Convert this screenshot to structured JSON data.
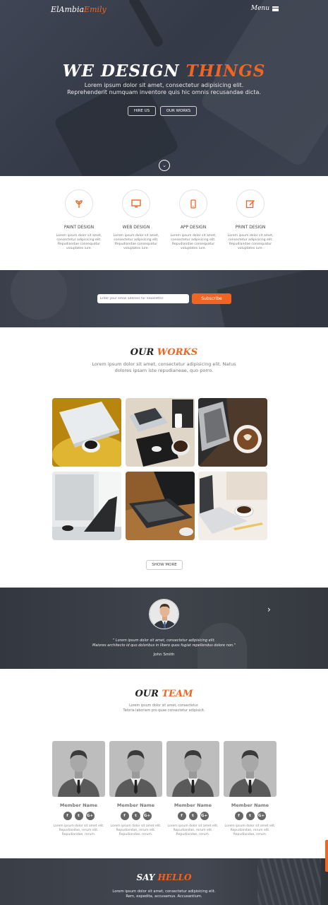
{
  "hero": {
    "logo_main": "ElAmbiaEmily",
    "logo_a": "ElAmbia",
    "logo_b": "Emily",
    "menu_label": "Menu",
    "title_a": "WE DESIGN ",
    "title_b": "THINGS",
    "subtitle_1": "Lorem ipsum dolor sit amet, consectetur adipisicing elit.",
    "subtitle_2": "Reprehenderit numquam inventore quis hic omnis recusandae dicta.",
    "btn_hire": "HIRE US",
    "btn_works": "OUR WORKS",
    "scroll_icon": "chevron-down-icon"
  },
  "services": [
    {
      "title": "PAINT DESIGN",
      "icon": "leaf-icon",
      "desc": "Lorem ipsum dolor sit amet, consectetur adipisicing elit. Repudiandae consequatur voluptates iure."
    },
    {
      "title": "WEB DESIGN",
      "icon": "monitor-icon",
      "desc": "Lorem ipsum dolor sit amet, consectetur adipisicing elit. Repudiandae consequatur voluptates iure."
    },
    {
      "title": "APP DESIGN",
      "icon": "mobile-icon",
      "desc": "Lorem ipsum dolor sit amet, consectetur adipisicing elit. Repudiandae consequatur voluptates iure."
    },
    {
      "title": "PRINT DESIGN",
      "icon": "edit-icon",
      "desc": "Lorem ipsum dolor sit amet, consectetur adipisicing elit. Repudiandae consequatur voluptates iure."
    }
  ],
  "subscribe": {
    "placeholder": "Enter your email address for newsletter",
    "button": "Subscribe"
  },
  "works": {
    "title_a": "OUR ",
    "title_b": "WORKS",
    "subtitle_1": "Lorem ipsum dolor sit amet, consectetur adipisicing elit. Natus",
    "subtitle_2": "dolores ipsam iste repudianeae, quo porro.",
    "show_more": "SHOW MORE"
  },
  "testimonial": {
    "quote_1": "\" Lorem ipsum dolor sit amet, consectetur adipisicing elit.",
    "quote_2": "Maiores architecto id quo doloribus in libero quos fugiat repellendus dolore non.\"",
    "name": "John Smith",
    "next_icon": "chevron-right-icon"
  },
  "team": {
    "title_a": "OUR ",
    "title_b": "TEAM",
    "subtitle_1": "Lorem ipsum dolor sit amet, consectetur.",
    "subtitle_2": "Tatoria laboriam pro quae consectetur adipisicit.",
    "members": [
      {
        "name": "Member Name",
        "desc": "Lorem ipsum dolor sit amet elit. Repudiandae, rerum elit. Repudiandae, rerum."
      },
      {
        "name": "Member Name",
        "desc": "Lorem ipsum dolor sit amet elit. Repudiandae, rerum elit. Repudiandae, rerum."
      },
      {
        "name": "Member Name",
        "desc": "Lorem ipsum dolor sit amet elit. Repudiandae, rerum elit. Repudiandae, rerum."
      },
      {
        "name": "Member Name",
        "desc": "Lorem ipsum dolor sit amet elit. Repudiandae, rerum elit. Repudiandae, rerum."
      }
    ],
    "social_icons": {
      "facebook": "f",
      "twitter": "t",
      "google": "G+"
    }
  },
  "hello": {
    "title_a": "SAY ",
    "title_b": "HELLO",
    "subtitle_1": "Lorem ipsum dolor sit amet, consectetur adipisicing elit.",
    "subtitle_2": "Rem, expedita, accusamus. Accusantium."
  },
  "colors": {
    "accent": "#f06522",
    "dark": "#3a3f4b"
  }
}
